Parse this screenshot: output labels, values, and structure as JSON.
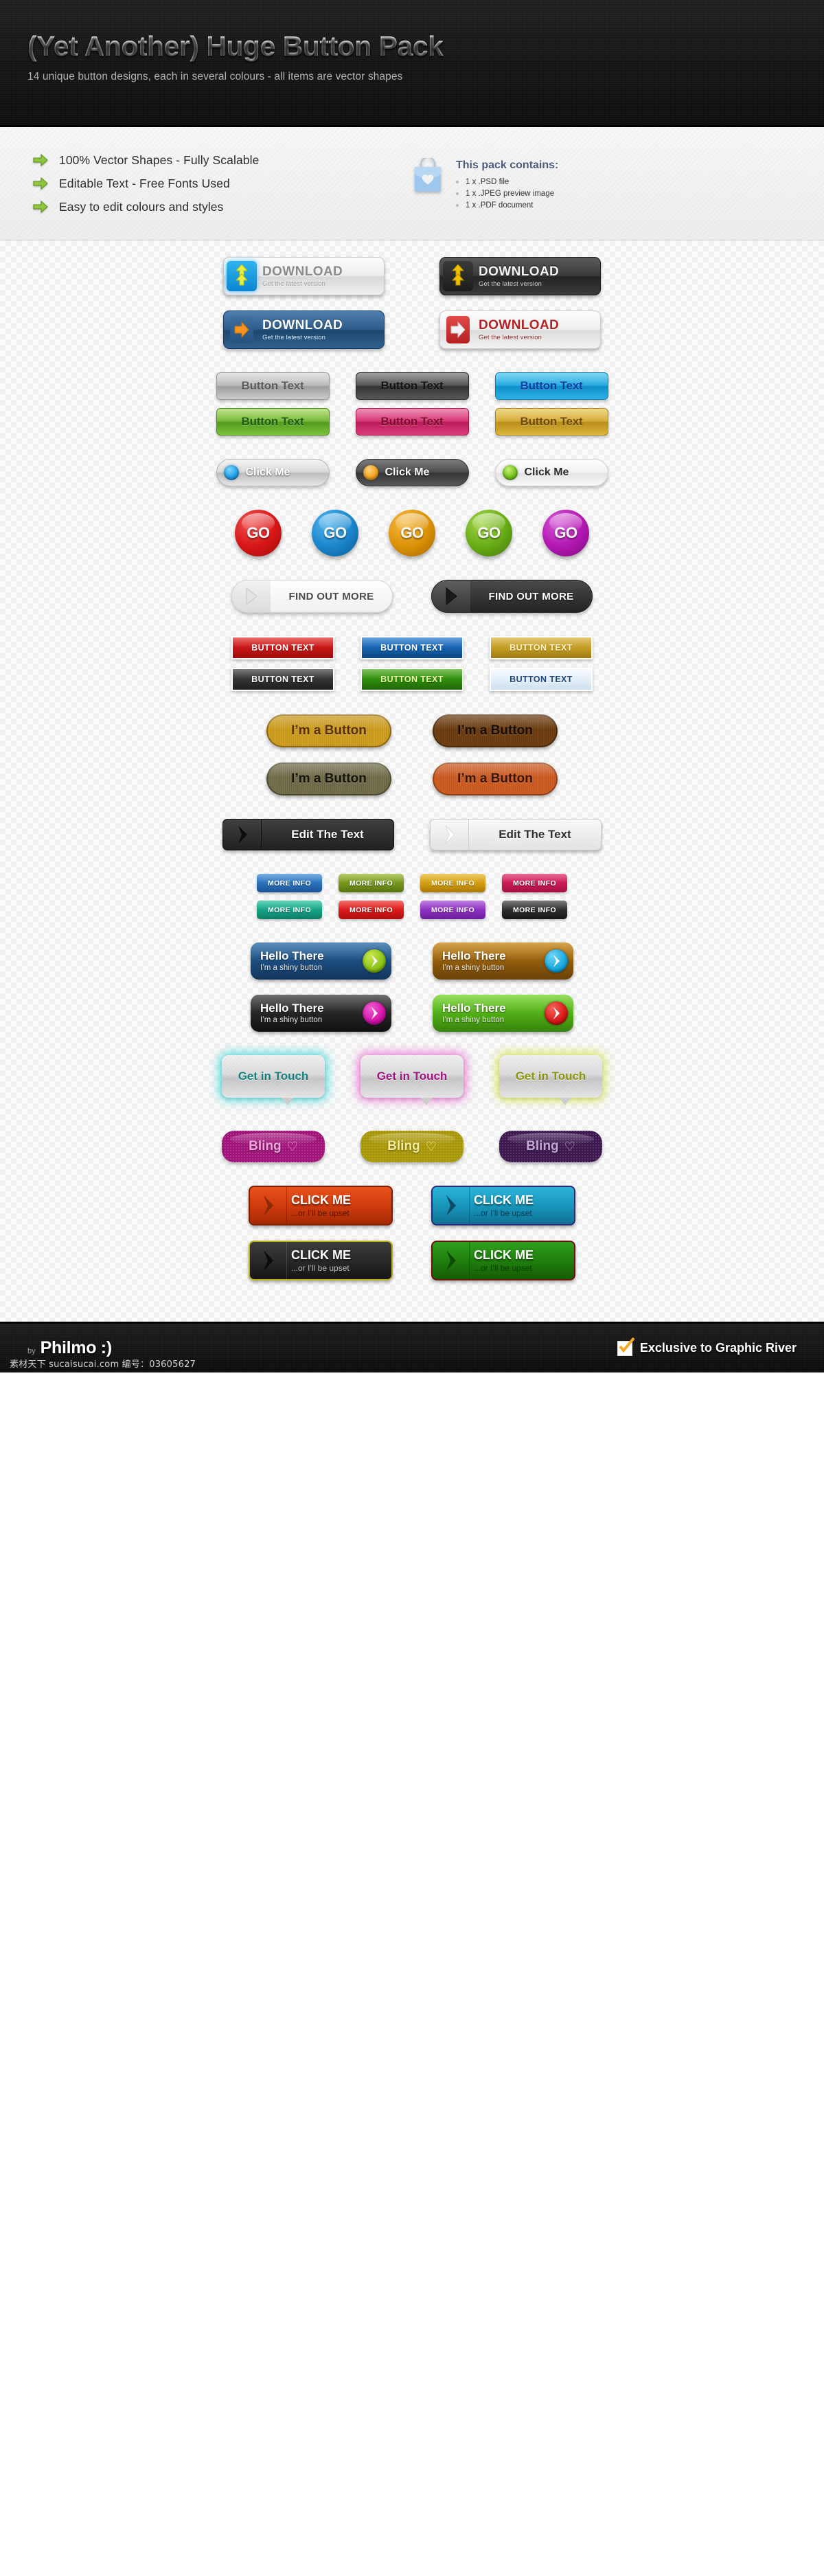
{
  "header": {
    "title": "(Yet Another) Huge Button Pack",
    "subtitle": "14 unique button designs, each in several colours - all items are vector shapes"
  },
  "features": {
    "items": [
      {
        "icon": "arrow-right-icon",
        "label": "100% Vector Shapes - Fully Scalable"
      },
      {
        "icon": "arrow-right-icon",
        "label": "Editable Text - Free Fonts Used"
      },
      {
        "icon": "arrow-right-icon",
        "label": "Easy to edit colours and styles"
      }
    ],
    "pack": {
      "icon": "shopping-bag-icon",
      "title": "This pack contains:",
      "items": [
        "1 x .PSD file",
        "1 x .JPEG preview image",
        "1 x .PDF document"
      ]
    }
  },
  "sections": {
    "download": {
      "title_text": "DOWNLOAD",
      "sub_text": "Get the latest version",
      "variants": [
        {
          "name": "silver-arrow-down",
          "class": "dl-silver",
          "icon": "download-arrow-icon"
        },
        {
          "name": "dark-arrow-down",
          "class": "dl-dark",
          "icon": "download-arrow-icon"
        },
        {
          "name": "blue-arrow-right",
          "class": "dl-blue",
          "icon": "arrow-right-icon"
        },
        {
          "name": "red-arrow-right",
          "class": "dl-red",
          "icon": "arrow-right-icon"
        }
      ]
    },
    "button_text_glossy": {
      "label": "Button Text",
      "variants": [
        {
          "name": "silver",
          "bg": "linear-gradient(180deg,#d6d6d6 0%,#b5b5b5 48%,#9e9e9e 52%,#cccccc 100%)",
          "color": "#5c5c5c",
          "border": "#9a9a9a"
        },
        {
          "name": "charcoal",
          "bg": "linear-gradient(180deg,#6b6b6b 0%,#4a4a4a 48%,#333333 52%,#585858 100%)",
          "color": "#141414",
          "border": "#2a2a2a"
        },
        {
          "name": "cyan",
          "bg": "linear-gradient(180deg,#3ec0ee 0%,#18a3dd 48%,#0f8ec9 52%,#2fb2e5 100%)",
          "color": "#0b3fa0",
          "border": "#0c7fb5"
        },
        {
          "name": "green",
          "bg": "linear-gradient(180deg,#9bd44f 0%,#6fb22e 48%,#539a1e 52%,#7ec23a 100%)",
          "color": "#1d5d13",
          "border": "#4e8e20"
        },
        {
          "name": "pink",
          "bg": "linear-gradient(180deg,#e8558f 0%,#d32a6c 48%,#b71d59 52%,#de3b7c 100%)",
          "color": "#7a0d2e",
          "border": "#a61a50"
        },
        {
          "name": "gold",
          "bg": "linear-gradient(180deg,#e6c24f 0%,#d1a52a 48%,#b88d18 52%,#dcb63c 100%)",
          "color": "#6e4a07",
          "border": "#ab8316"
        }
      ]
    },
    "click_me": {
      "label": "Click Me",
      "variants": [
        {
          "name": "silver-blue-led",
          "class": "silver",
          "led": "radial-gradient(circle at 38% 30%, #7fd6ff 0%, #1f9fe8 55%, #0b6fb8 100%)"
        },
        {
          "name": "dark-orange-led",
          "class": "dark",
          "led": "radial-gradient(circle at 38% 30%, #ffd27f 0%, #f5a623 55%, #c97a05 100%)"
        },
        {
          "name": "white-green-led",
          "class": "white",
          "led": "radial-gradient(circle at 38% 30%, #c9f07a 0%, #73c21a 55%, #4d8f08 100%)"
        }
      ]
    },
    "go_orbs": {
      "label": "GO",
      "variants": [
        {
          "name": "red",
          "bg": "radial-gradient(circle at 35% 28%, #f05555 0%, #d81717 52%, #9e0b0b 100%)"
        },
        {
          "name": "blue",
          "bg": "radial-gradient(circle at 35% 28%, #55b6ef 0%, #1b86cc 52%, #0b5c95 100%)"
        },
        {
          "name": "orange",
          "bg": "radial-gradient(circle at 35% 28%, #f5bb46 0%, #dd9208 52%, #a66703 100%)"
        },
        {
          "name": "green",
          "bg": "radial-gradient(circle at 35% 28%, #a6d74e 0%, #68ad17 52%, #44780a 100%)"
        },
        {
          "name": "purple",
          "bg": "radial-gradient(circle at 35% 28%, #d558d5 0%, #b318b3 52%, #7d0b7d 100%)"
        }
      ]
    },
    "find_out_more": {
      "label": "FIND OUT MORE",
      "variants": [
        {
          "name": "light",
          "class": "light",
          "arrow_color": "#d8d8d8"
        },
        {
          "name": "dark",
          "class": "dark",
          "arrow_color": "#171717"
        }
      ]
    },
    "button_text_flat": {
      "label": "BUTTON TEXT",
      "variants": [
        {
          "name": "red",
          "bg": "linear-gradient(180deg,#e33434 0%,#c31414 55%,#9d0c0c 100%)",
          "color": "#ffffff"
        },
        {
          "name": "blue",
          "bg": "linear-gradient(180deg,#2e7fd0 0%,#1560ac 55%,#0d4581 100%)",
          "color": "#ffffff"
        },
        {
          "name": "gold",
          "bg": "linear-gradient(180deg,#d8b441 0%,#c29a22 55%,#9d7a10 100%)",
          "color": "#fdf3c7"
        },
        {
          "name": "carbon",
          "bg": "linear-gradient(180deg,#4a4a4a 0%,#323232 55%,#1d1d1d 100%)",
          "color": "#ffffff"
        },
        {
          "name": "green",
          "bg": "linear-gradient(180deg,#4fae22 0%,#2f8b0d 55%,#1f6606 100%)",
          "color": "#e9f9a8"
        },
        {
          "name": "ice",
          "bg": "linear-gradient(180deg,#f4f9fd 0%,#e2edf7 55%,#cfe0ef 100%)",
          "color": "#1d4576"
        }
      ]
    },
    "im_a_button": {
      "label": "I’m a Button",
      "variants": [
        {
          "name": "gold-wood",
          "bg": "linear-gradient(180deg,#e8c34b 0%,#c99a20 50%,#a8760f 100%)",
          "color": "#5b2f06",
          "border": "#8d6410"
        },
        {
          "name": "brown-wood",
          "bg": "linear-gradient(180deg,#7a5a22 0%,#6b3d12 50%,#7e3a10 100%)",
          "color": "#170c03",
          "border": "#4b2a0a"
        },
        {
          "name": "olive-wood",
          "bg": "linear-gradient(180deg,#a0a077 0%,#6e6b4a 50%,#4a4222 100%)",
          "color": "#15140a",
          "border": "#4d4a2c"
        },
        {
          "name": "orange-wood",
          "bg": "linear-gradient(180deg,#e08a4e 0%,#c85a22 50%,#a63d12 100%)",
          "color": "#3a1405",
          "border": "#8f4014"
        }
      ]
    },
    "edit_the_text": {
      "label": "Edit The Text",
      "variants": [
        {
          "name": "dark",
          "class": "dark",
          "chevron_fill": "#0c0c0c"
        },
        {
          "name": "light",
          "class": "light",
          "chevron_fill": "#ffffff"
        }
      ]
    },
    "more_info": {
      "label": "MORE INFO",
      "variants": [
        {
          "name": "blue",
          "bg": "linear-gradient(180deg,#4a91d8 0%,#2a6fb8 55%,#1b5496 100%)"
        },
        {
          "name": "olive",
          "bg": "linear-gradient(180deg,#9bb93a 0%,#74941c 55%,#587211 100%)"
        },
        {
          "name": "gold",
          "bg": "linear-gradient(180deg,#e5b931 0%,#d09b0e 55%,#a87a07 100%)"
        },
        {
          "name": "pink",
          "bg": "linear-gradient(180deg,#e03a74 0%,#c71a54 55%,#a2113f 100%)"
        },
        {
          "name": "teal",
          "bg": "linear-gradient(180deg,#2fc2a0 0%,#16a184 55%,#0d7c65 100%)"
        },
        {
          "name": "red",
          "bg": "linear-gradient(180deg,#ef3b3b 0%,#d91818 55%,#ad0e0e 100%)"
        },
        {
          "name": "purple",
          "bg": "linear-gradient(180deg,#a855d8 0%,#8a2fc0 55%,#6c1d9b 100%)"
        },
        {
          "name": "black",
          "bg": "linear-gradient(180deg,#4e4e4e 0%,#2c2c2c 55%,#151515 100%)"
        }
      ]
    },
    "hello_there": {
      "title": "Hello There",
      "subtitle": "I’m a shiny button",
      "variants": [
        {
          "name": "blue",
          "bg": "linear-gradient(180deg,#2f6ea8 0%,#1b4b7c 55%,#10355c 100%)",
          "orb": "radial-gradient(circle at 35% 28%, #c9e84f 0%, #8cc215 60%, #5e8c06 100%)"
        },
        {
          "name": "brown",
          "bg": "linear-gradient(180deg,#c98a1a 0%,#8d5a0c 55%,#6a4208 100%)",
          "orb": "radial-gradient(circle at 35% 28%, #6fd4f5 0%, #18a8e0 60%, #0b76a8 100%)"
        },
        {
          "name": "black",
          "bg": "linear-gradient(180deg,#454545 0%,#232323 55%,#111111 100%)",
          "orb": "radial-gradient(circle at 35% 28%, #f05ed0 0%, #d311a8 60%, #980878 100%)"
        },
        {
          "name": "green",
          "bg": "linear-gradient(180deg,#78d531 0%,#4fab16 55%,#36820c 100%)",
          "orb": "radial-gradient(circle at 35% 28%, #f5655a 0%, #d81818 60%, #9c0d0d 100%)"
        }
      ]
    },
    "get_in_touch": {
      "label": "Get in Touch",
      "variants": [
        {
          "name": "teal",
          "glow": "#3fd6d6",
          "color": "#17807f"
        },
        {
          "name": "pink",
          "glow": "#e86fd0",
          "color": "#9c1684"
        },
        {
          "name": "olive",
          "glow": "#d6e24a",
          "color": "#8d9410"
        }
      ]
    },
    "bling": {
      "label": "Bling",
      "heart": "♡",
      "variants": [
        {
          "name": "magenta",
          "bg": "linear-gradient(180deg,#c31d95 0%,#a0147a 50%,#7d0d5e 100%)",
          "color": "#f0a8de"
        },
        {
          "name": "gold",
          "bg": "linear-gradient(180deg,#c9b70d 0%,#a89708 50%,#857705 100%)",
          "color": "#f5ed9b"
        },
        {
          "name": "purple",
          "bg": "linear-gradient(180deg,#4f1f66 0%,#3d1750 50%,#2b0f39 100%)",
          "color": "#c4a8d6"
        }
      ]
    },
    "click_me_big": {
      "title": "CLICK ME",
      "subtitle": "...or I’ll be upset",
      "variants": [
        {
          "name": "orange",
          "bg": "linear-gradient(180deg,#e8511c 0%,#cc3a0c 55%,#a32a06 100%)",
          "border": "#7a1f04",
          "sub_color": "#521303",
          "arrow": "#8c2a06"
        },
        {
          "name": "cyan",
          "bg": "linear-gradient(180deg,#2bb4d8 0%,#1892b8 55%,#0f7294 100%)",
          "border": "#2d2a7a",
          "sub_color": "#0a3a4e",
          "arrow": "#0d4a66"
        },
        {
          "name": "black",
          "bg": "linear-gradient(180deg,#3c3c3c 0%,#272727 55%,#151515 100%)",
          "border": "#b9b018",
          "sub_color": "#b8b8b8",
          "arrow": "#0b0b0b"
        },
        {
          "name": "green",
          "bg": "linear-gradient(180deg,#2f9e1c 0%,#1f7c0d 55%,#145c06 100%)",
          "border": "#6e1010",
          "sub_color": "#0c3a04",
          "arrow": "#0f4a05"
        }
      ]
    }
  },
  "footer": {
    "by_prefix": "by",
    "author": "Philmo :)",
    "exclusive": "Exclusive to Graphic River",
    "watermark": "素材天下 sucaisucai.com 编号：03605627"
  }
}
